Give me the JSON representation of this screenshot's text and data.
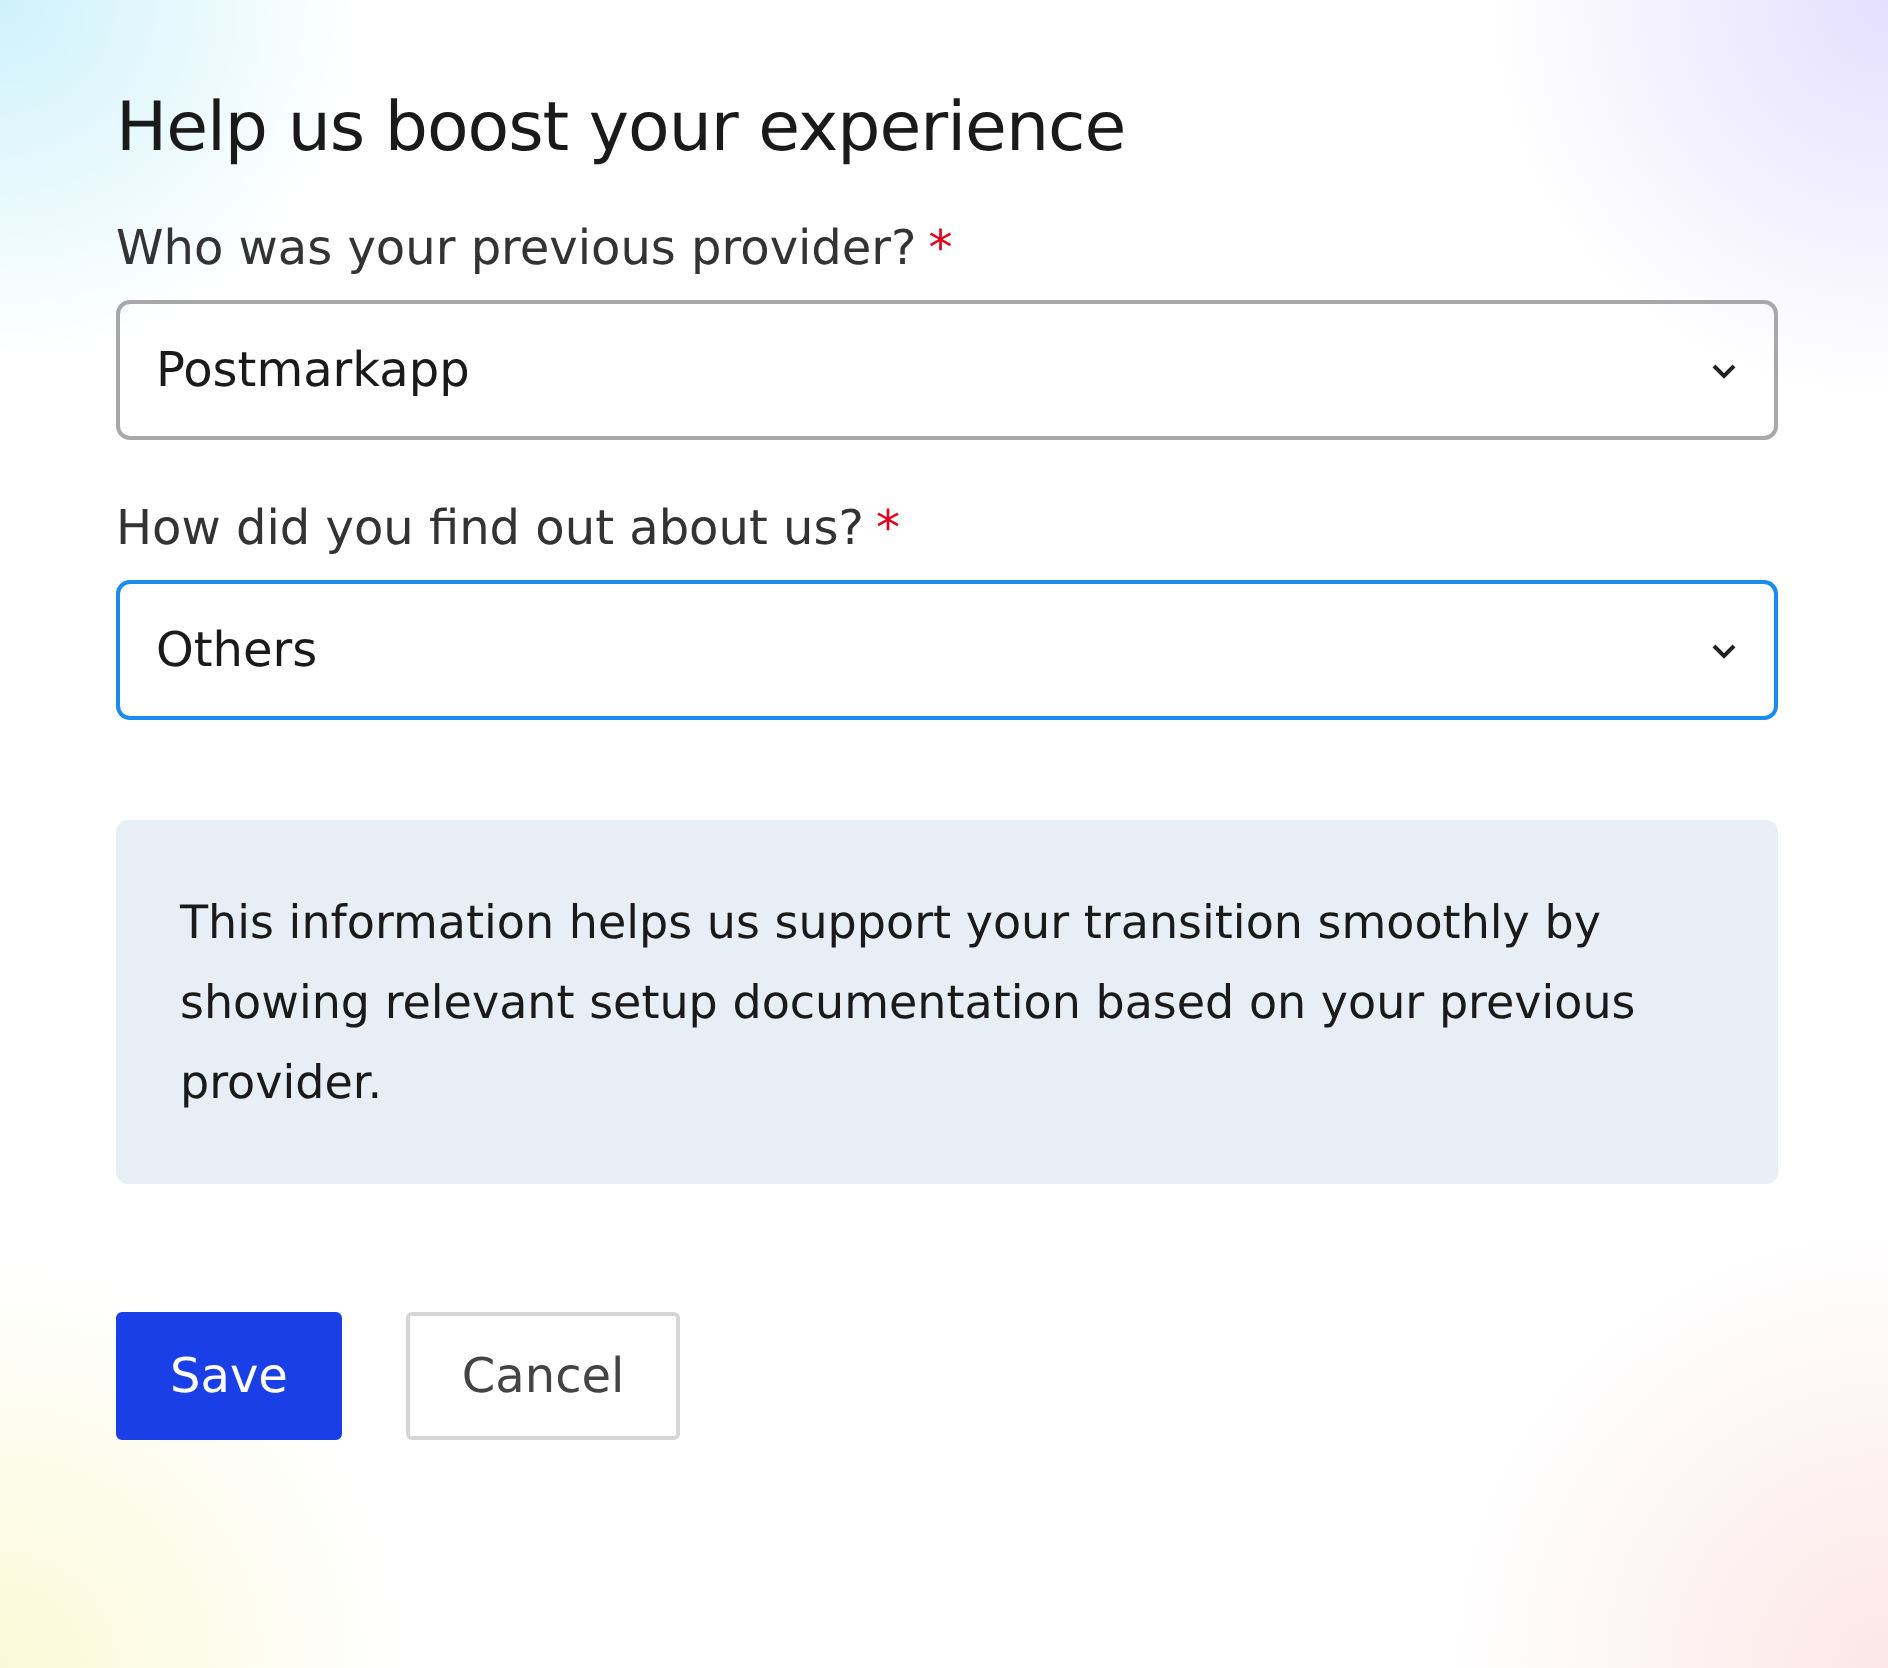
{
  "title": "Help us boost your experience",
  "fields": [
    {
      "label": "Who was your previous provider?",
      "required_mark": "*",
      "value": "Postmarkapp",
      "focused": false
    },
    {
      "label": "How did you find out about us?",
      "required_mark": "*",
      "value": "Others",
      "focused": true
    }
  ],
  "info": "This information helps us support your transition smoothly by showing relevant setup documentation based on your previous provider.",
  "buttons": [
    {
      "label": "Save",
      "kind": "primary"
    },
    {
      "label": "Cancel",
      "kind": "secondary"
    }
  ]
}
